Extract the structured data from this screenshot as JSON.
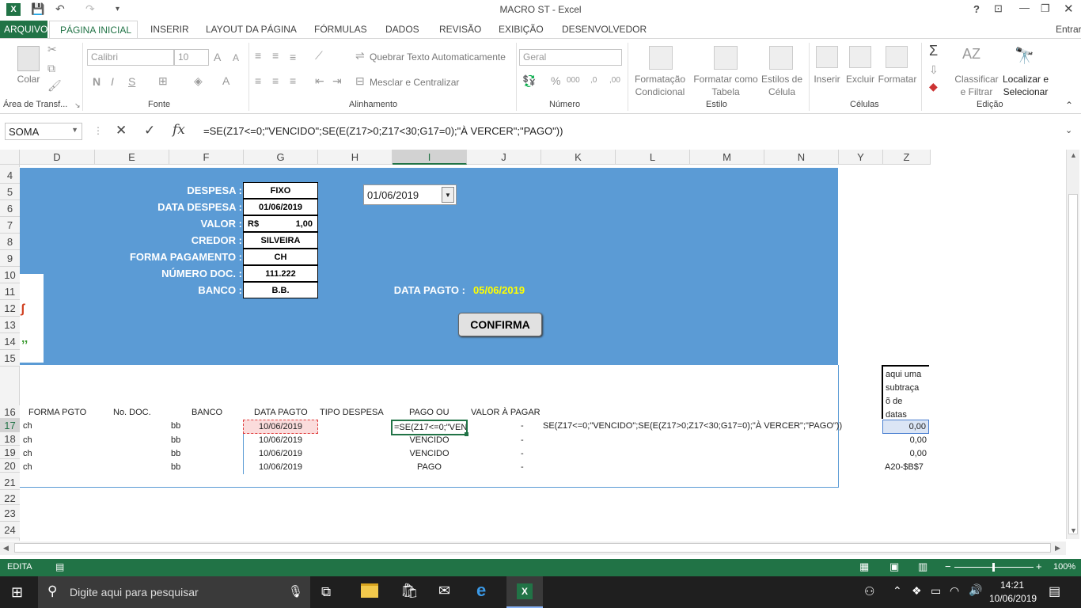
{
  "window": {
    "title": "MACRO ST - Excel",
    "controls": [
      "?",
      "□",
      "—",
      "❐",
      "✕"
    ]
  },
  "tabs": {
    "arquivo": "ARQUIVO",
    "items": [
      "PÁGINA INICIAL",
      "INSERIR",
      "LAYOUT DA PÁGINA",
      "FÓRMULAS",
      "DADOS",
      "REVISÃO",
      "EXIBIÇÃO",
      "DESENVOLVEDOR"
    ],
    "signin": "Entrar"
  },
  "ribbon": {
    "clipboard": {
      "paste": "Colar",
      "group": "Área de Transf..."
    },
    "font": {
      "name": "Calibri",
      "size": "10",
      "group": "Fonte"
    },
    "alignment": {
      "wrap": "Quebrar Texto Automaticamente",
      "merge": "Mesclar e Centralizar",
      "group": "Alinhamento"
    },
    "number": {
      "format": "Geral",
      "group": "Número"
    },
    "styles": {
      "cond": "Formatação Condicional",
      "table": "Formatar como Tabela",
      "cell": "Estilos de Célula",
      "group": "Estilo"
    },
    "cells": {
      "insert": "Inserir",
      "delete": "Excluir",
      "format": "Formatar",
      "group": "Células"
    },
    "editing": {
      "sort": "Classificar e Filtrar",
      "find": "Localizar e Selecionar",
      "group": "Edição"
    }
  },
  "formula_bar": {
    "name_box": "SOMA",
    "fx": "fx",
    "formula": "=SE(Z17<=0;\"VENCIDO\";SE(E(Z17>0;Z17<30;G17=0);\"À VERCER\";\"PAGO\"))"
  },
  "grid": {
    "columns": [
      "D",
      "E",
      "F",
      "G",
      "H",
      "I",
      "J",
      "K",
      "L",
      "M",
      "N",
      "Y",
      "Z"
    ],
    "rows": [
      "4",
      "5",
      "6",
      "7",
      "8",
      "9",
      "10",
      "11",
      "12",
      "13",
      "14",
      "15",
      "16",
      "17",
      "18",
      "19",
      "20",
      "21",
      "22",
      "23",
      "24"
    ]
  },
  "form": {
    "despesa_label": "DESPESA :",
    "despesa": "FIXO",
    "data_label": "DATA DESPESA :",
    "data": "01/06/2019",
    "valor_label": "VALOR :",
    "valor_currency": "R$",
    "valor": "1,00",
    "credor_label": "CREDOR :",
    "credor": "SILVEIRA",
    "forma_label": "FORMA PAGAMENTO :",
    "forma": "CH",
    "numdoc_label": "NÚMERO DOC. :",
    "numdoc": "111.222",
    "banco_label": "BANCO :",
    "banco": "B.B.",
    "date_picker": "01/06/2019",
    "data_pagto_label": "DATA PAGTO :",
    "data_pagto": "05/06/2019",
    "confirm": "CONFIRMA"
  },
  "table": {
    "headers": [
      "FORMA PGTO",
      "No. DOC.",
      "BANCO",
      "DATA PAGTO",
      "TIPO DESPESA",
      "PAGO OU",
      "VALOR À PAGAR"
    ],
    "note": [
      "aqui uma",
      "subtraça",
      "õ de",
      "datas"
    ],
    "rows": [
      {
        "forma": "ch",
        "banco": "bb",
        "data": "10/06/2019",
        "status": "=SE(Z17<=0;\"VEN",
        "valor": "-",
        "z": "0,00"
      },
      {
        "forma": "ch",
        "banco": "bb",
        "data": "10/06/2019",
        "status": "VENCIDO",
        "valor": "-",
        "z": "0,00"
      },
      {
        "forma": "ch",
        "banco": "bb",
        "data": "10/06/2019",
        "status": "VENCIDO",
        "valor": "-",
        "z": "0,00"
      },
      {
        "forma": "ch",
        "banco": "bb",
        "data": "10/06/2019",
        "status": "PAGO",
        "valor": "-",
        "z": "A20-$B$7"
      }
    ],
    "overflow_text": "SE(Z17<=0;\"VENCIDO\";SE(E(Z17>0;Z17<30;G17=0);\"À VERCER\";\"PAGO\"))"
  },
  "status_bar": {
    "mode": "EDITA",
    "zoom": "100%"
  },
  "taskbar": {
    "search_placeholder": "Digite aqui para pesquisar",
    "time": "14:21",
    "date": "10/06/2019"
  }
}
